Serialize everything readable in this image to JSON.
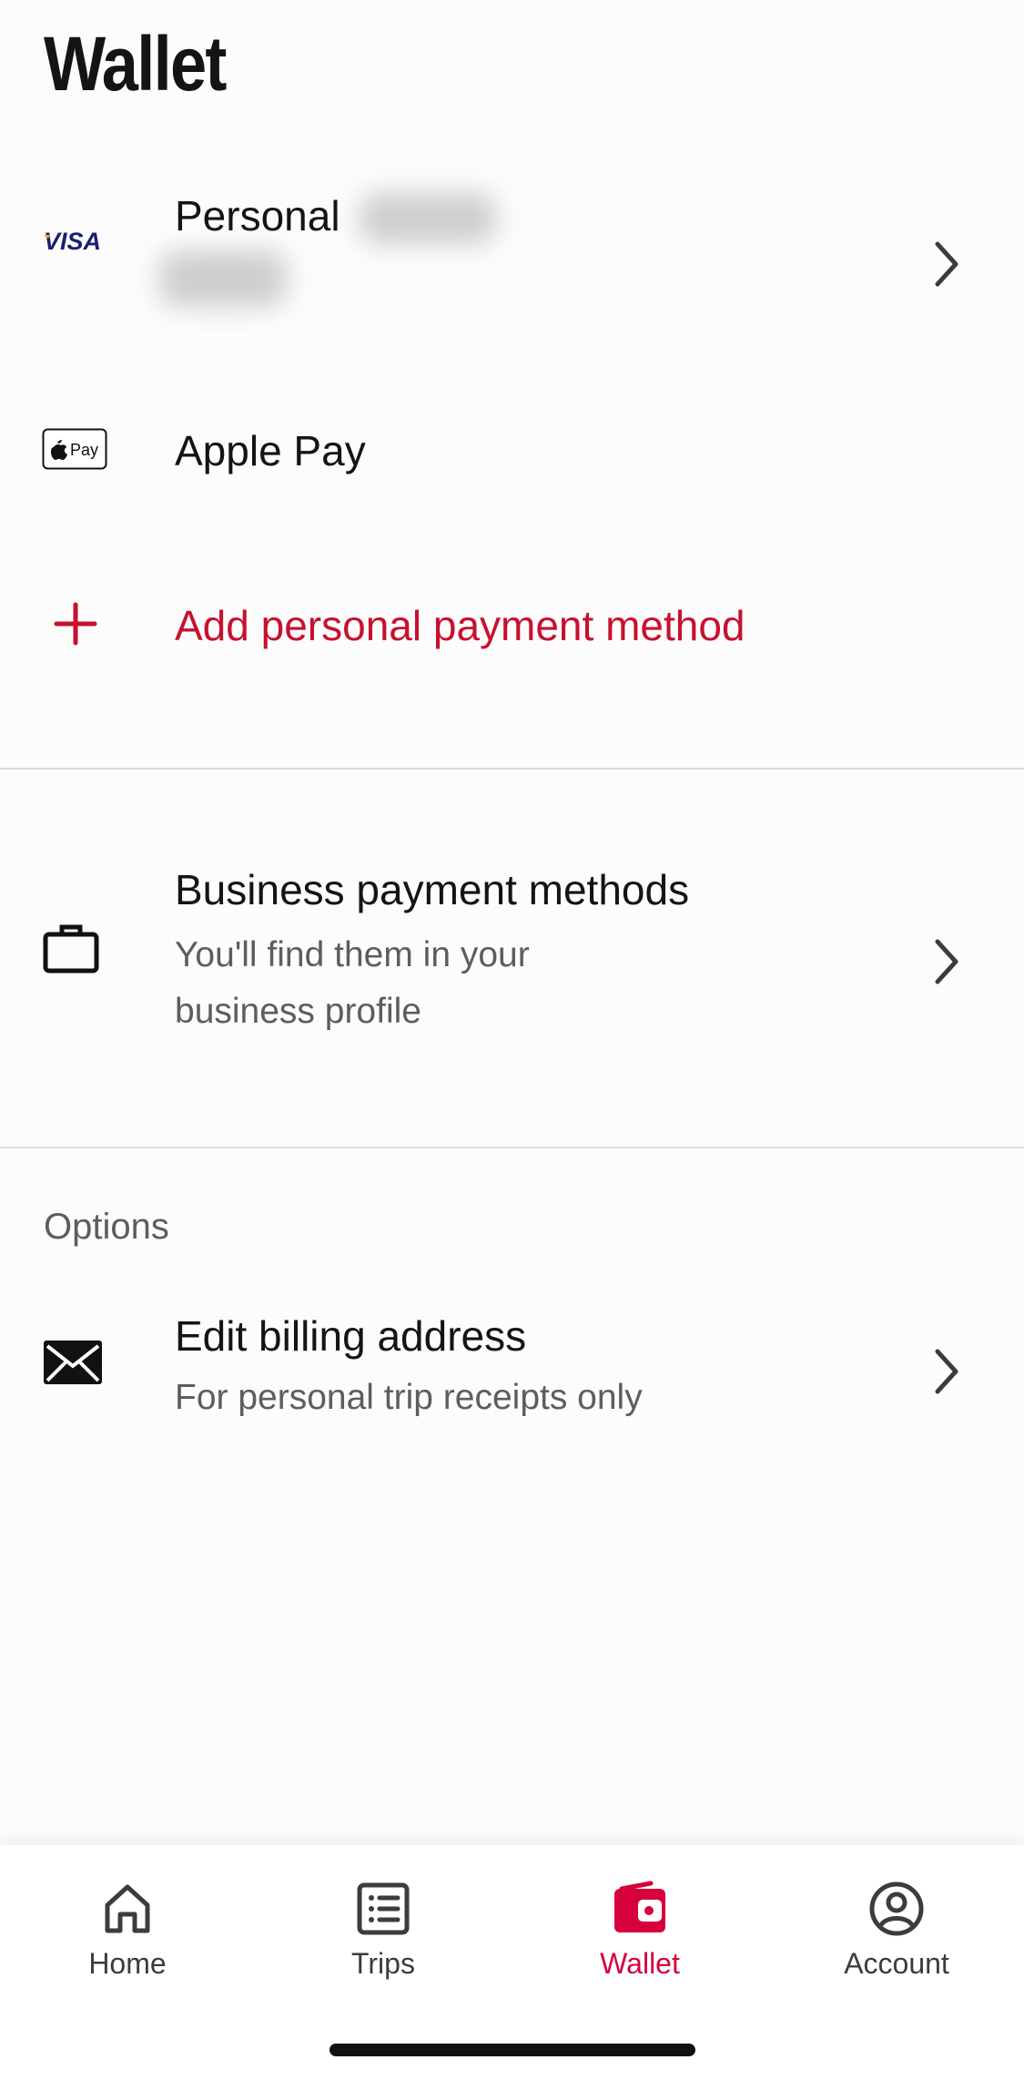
{
  "page": {
    "title": "Wallet"
  },
  "personal_methods": [
    {
      "brand": "VISA",
      "label": "Personal",
      "icon": "visa-logo"
    },
    {
      "brand": "Pay",
      "label": "Apple Pay",
      "icon": "apple-pay-logo"
    }
  ],
  "add_method": {
    "label": "Add personal payment method",
    "icon": "plus-icon"
  },
  "business": {
    "title": "Business payment methods",
    "subtitle_line1": "You'll find them in your",
    "subtitle_line2": "business profile",
    "icon": "briefcase-icon"
  },
  "options": {
    "section_label": "Options",
    "billing": {
      "title": "Edit billing address",
      "subtitle": "For personal trip receipts only",
      "icon": "envelope-icon"
    }
  },
  "bottom_nav": {
    "items": [
      {
        "label": "Home",
        "icon": "home-icon",
        "active": false
      },
      {
        "label": "Trips",
        "icon": "list-icon",
        "active": false
      },
      {
        "label": "Wallet",
        "icon": "wallet-icon",
        "active": true
      },
      {
        "label": "Account",
        "icon": "account-icon",
        "active": false
      }
    ]
  },
  "colors": {
    "accent": "#c8102e",
    "nav_active": "#d6003c",
    "visa_blue": "#1a1f71",
    "visa_gold": "#f7a600"
  }
}
